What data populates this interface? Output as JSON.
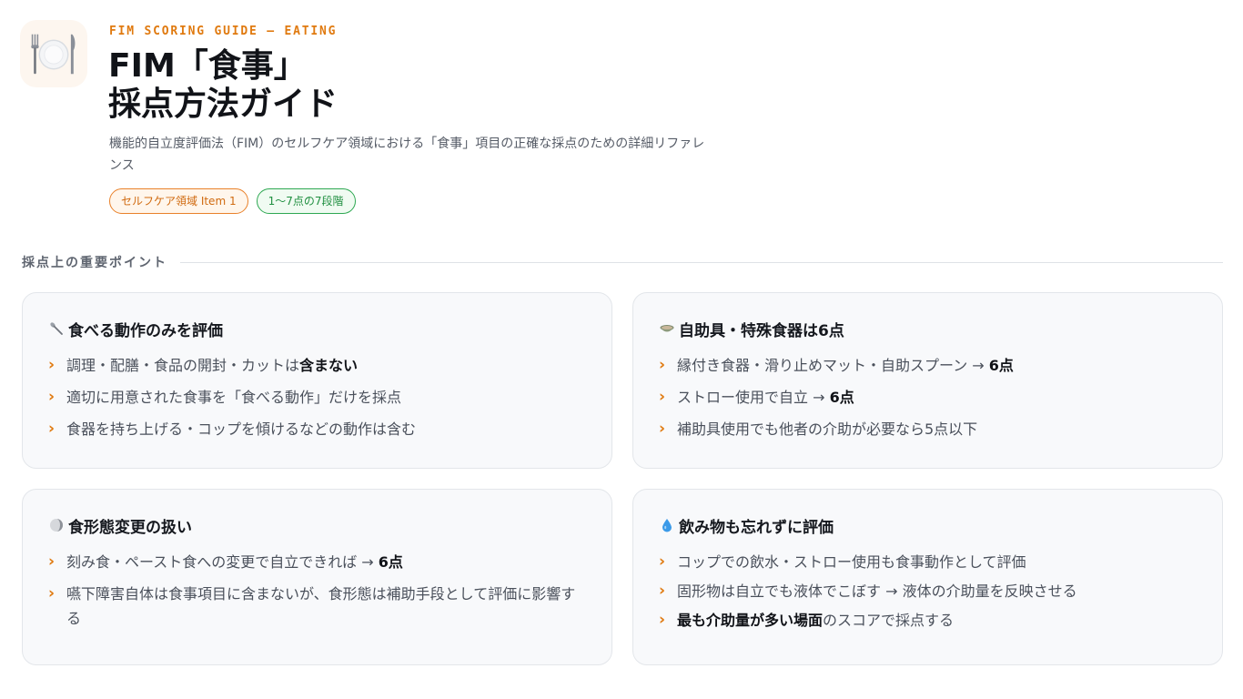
{
  "header": {
    "icon": "plate-fork-knife-icon",
    "eyebrow": "FIM SCORING GUIDE — EATING",
    "title_line1": "FIM「食事」",
    "title_line2": "採点方法ガイド",
    "subtitle": "機能的自立度評価法（FIM）のセルフケア領域における「食事」項目の正確な採点のための詳細リファレンス",
    "badges": [
      {
        "label": "セルフケア領域 Item 1",
        "color": "#e9812a"
      },
      {
        "label": "1〜7点の7段階",
        "color": "#2ea852"
      }
    ]
  },
  "section": {
    "label": "採点上の重要ポイント"
  },
  "cards": [
    {
      "icon": "spoon-icon",
      "title": "食べる動作のみを評価",
      "items": [
        {
          "text": "調理・配膳・食品の開封・カットは",
          "bold": "含まない",
          "after": ""
        },
        {
          "text": "適切に用意された食事を「食べる動作」だけを採点",
          "bold": "",
          "after": ""
        },
        {
          "text": "食器を持ち上げる・コップを傾けるなどの動作は含む",
          "bold": "",
          "after": ""
        }
      ]
    },
    {
      "icon": "bowl-icon",
      "title": "自助具・特殊食器は6点",
      "items": [
        {
          "text": "縁付き食器・滑り止めマット・自助スプーン → ",
          "bold": "6点",
          "after": ""
        },
        {
          "text": "ストロー使用で自立 → ",
          "bold": "6点",
          "after": ""
        },
        {
          "text": "補助具使用でも他者の介助が必要なら5点以下",
          "bold": "",
          "after": ""
        }
      ]
    },
    {
      "icon": "moon-icon",
      "title": "食形態変更の扱い",
      "items": [
        {
          "text": "刻み食・ペースト食への変更で自立できれば → ",
          "bold": "6点",
          "after": ""
        },
        {
          "text": "嚥下障害自体は食事項目に含まないが、食形態は補助手段として評価に影響する",
          "bold": "",
          "after": ""
        }
      ]
    },
    {
      "icon": "droplet-icon",
      "title": "飲み物も忘れずに評価",
      "items": [
        {
          "text": "コップでの飲水・ストロー使用も食事動作として評価",
          "bold": "",
          "after": ""
        },
        {
          "text": "固形物は自立でも液体でこぼす → 液体の介助量を反映させる",
          "bold": "",
          "after": ""
        },
        {
          "text": "",
          "bold": "最も介助量が多い場面",
          "after": "のスコアで採点する"
        }
      ]
    }
  ],
  "colors": {
    "accent_orange": "#e07a10",
    "accent_green": "#2ea852",
    "card_bg": "#f8f9fb",
    "card_border": "#e3e6ea"
  }
}
